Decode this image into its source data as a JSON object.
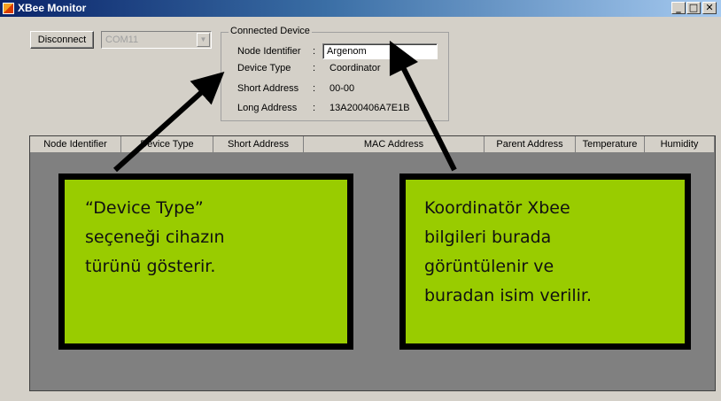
{
  "window": {
    "title": "XBee Monitor",
    "minimize": "_",
    "maximize": "□",
    "close": "✕"
  },
  "toolbar": {
    "disconnect_label": "Disconnect",
    "port_value": "COM11",
    "port_dropdown": "▼"
  },
  "device": {
    "group_title": "Connected Device",
    "separator": ":",
    "node_identifier_label": "Node Identifier",
    "node_identifier_value": "Argenom",
    "device_type_label": "Device Type",
    "device_type_value": "Coordinator",
    "short_address_label": "Short Address",
    "short_address_value": "00-00",
    "long_address_label": "Long Address",
    "long_address_value": "13A200406A7E1B"
  },
  "grid": {
    "columns": [
      "Node Identifier",
      "Device Type",
      "Short Address",
      "MAC Address",
      "Parent Address",
      "Temperature",
      "Humidity"
    ]
  },
  "annotations": {
    "left": [
      "“Device Type”",
      "seçeneği cihazın",
      "türünü gösterir."
    ],
    "right": [
      "Koordinatör Xbee",
      "bilgileri burada",
      "görüntülenir ve",
      "buradan isim verilir."
    ]
  },
  "colors": {
    "callout_fill": "#99cc00",
    "titlebar": "#0a246a",
    "grid_bg": "#808080"
  }
}
